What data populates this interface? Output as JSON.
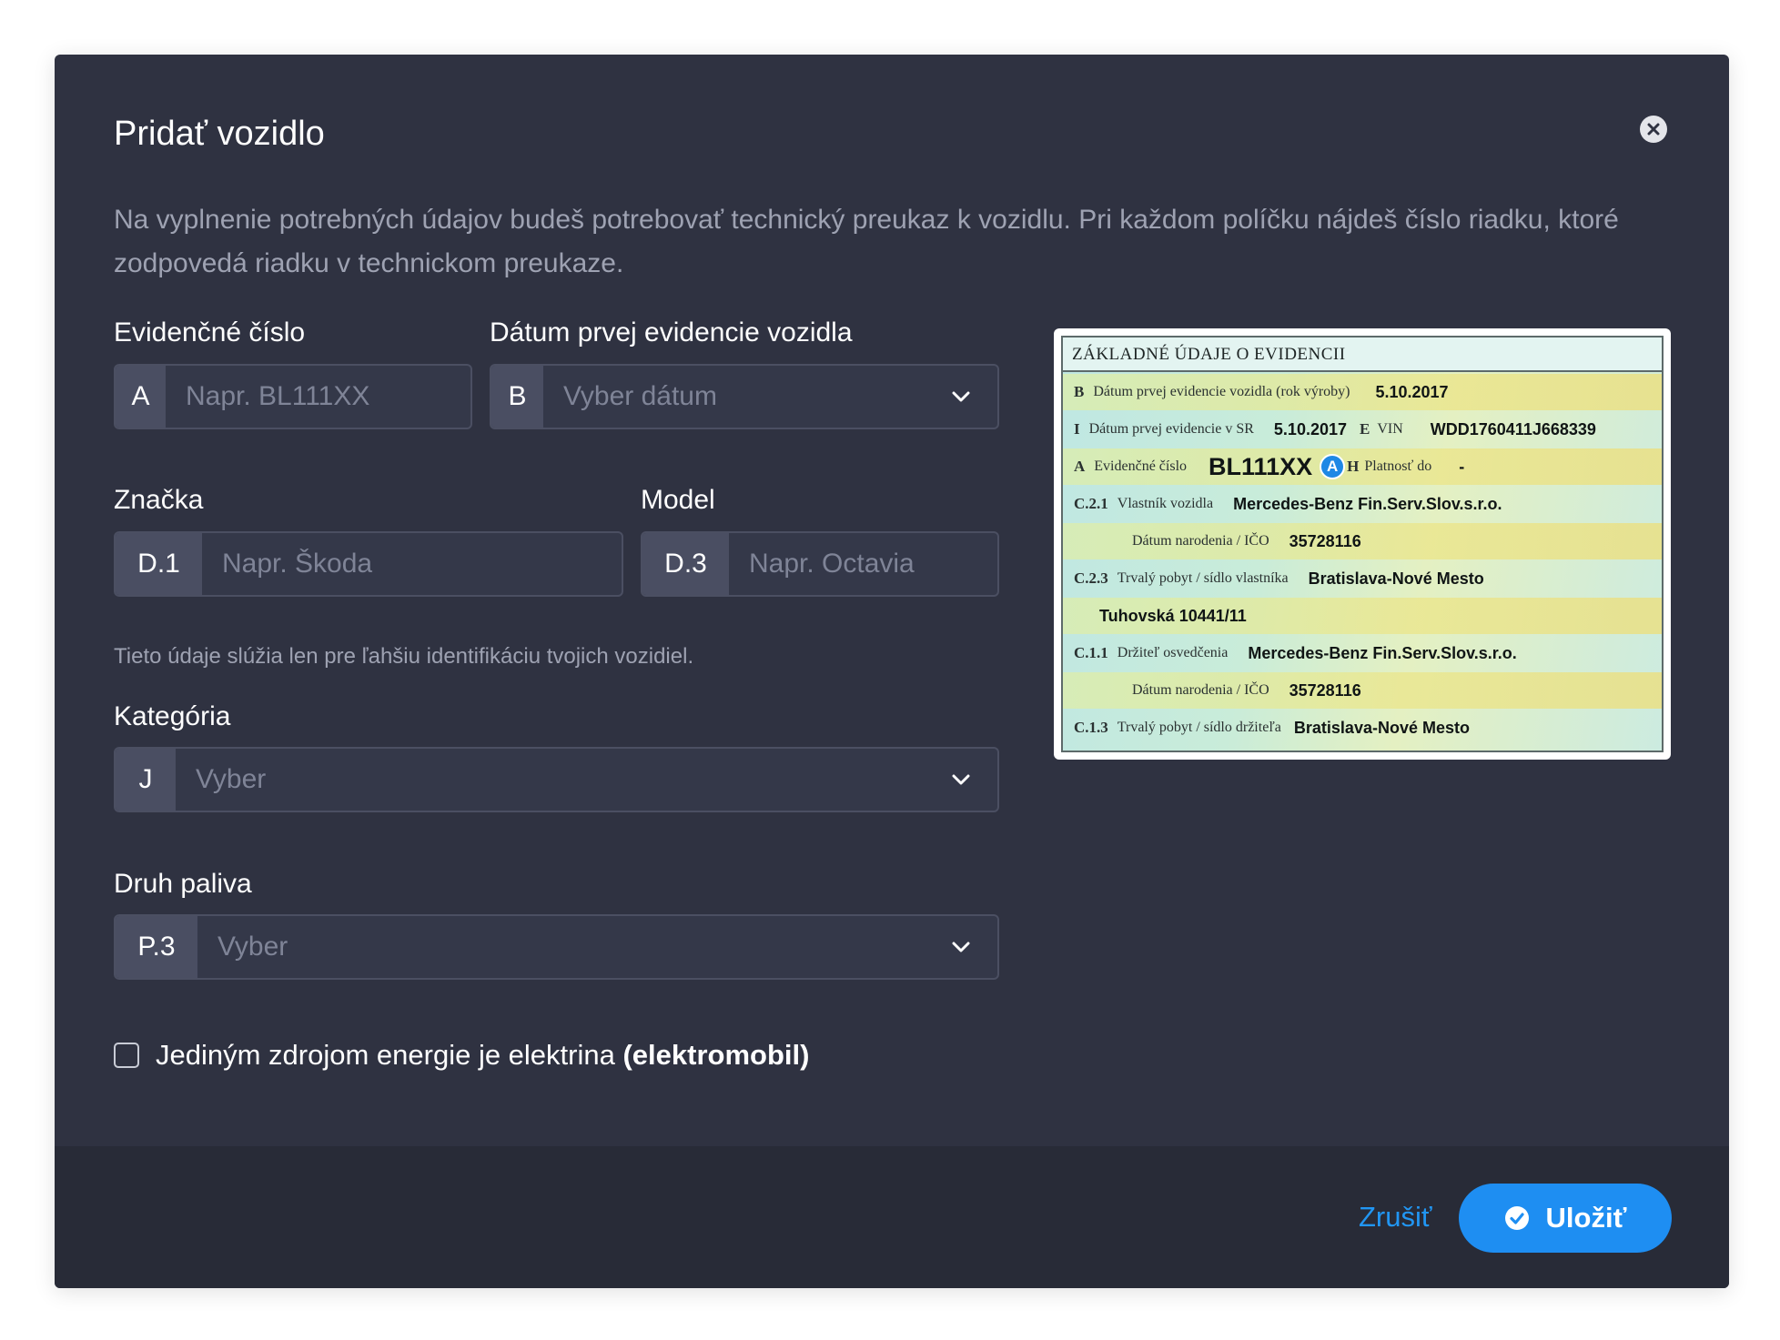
{
  "dialog": {
    "title": "Pridať vozidlo",
    "close_icon": "close-icon",
    "intro": "Na vyplnenie potrebných údajov budeš potrebovať technický preukaz k vozidlu. Pri každom políčku nájdeš číslo riadku, ktoré zodpovedá riadku v technickom preukaze."
  },
  "fields": {
    "plate": {
      "label": "Evidenčné číslo",
      "prefix": "A",
      "placeholder": "Napr. BL111XX",
      "value": ""
    },
    "first_registration": {
      "label": "Dátum prvej evidencie vozidla",
      "prefix": "B",
      "placeholder": "Vyber dátum"
    },
    "brand": {
      "label": "Značka",
      "prefix": "D.1",
      "placeholder": "Napr. Škoda",
      "value": ""
    },
    "model": {
      "label": "Model",
      "prefix": "D.3",
      "placeholder": "Napr. Octavia",
      "value": ""
    },
    "hint": "Tieto údaje slúžia len pre ľahšiu identifikáciu tvojich vozidiel.",
    "category": {
      "label": "Kategória",
      "prefix": "J",
      "placeholder": "Vyber"
    },
    "fuel": {
      "label": "Druh paliva",
      "prefix": "P.3",
      "placeholder": "Vyber"
    },
    "electric": {
      "label": "Jediným zdrojom energie je elektrina",
      "label_bold": "(elektromobil)",
      "checked": false
    }
  },
  "document_image": {
    "title": "ZÁKLADNÉ ÚDAJE O EVIDENCII",
    "rows": [
      {
        "code": "B",
        "label": "Dátum prvej evidencie vozidla (rok výroby)",
        "value": "5.10.2017"
      },
      {
        "code": "I",
        "label": "Dátum prvej evidencie v SR",
        "value": "5.10.2017",
        "code2": "E",
        "label2": "VIN",
        "value2": "WDD1760411J668339"
      },
      {
        "code": "A",
        "label": "Evidenčné číslo",
        "value": "BL111XX",
        "badge": "A",
        "code2": "H",
        "label2": "Platnosť do",
        "value2": "-"
      },
      {
        "code": "C.2.1",
        "label": "Vlastník vozidla",
        "value": "Mercedes-Benz Fin.Serv.Slov.s.r.o."
      },
      {
        "code": "",
        "label": "Dátum narodenia / IČO",
        "value": "35728116"
      },
      {
        "code": "C.2.3",
        "label": "Trvalý pobyt / sídlo vlastníka",
        "value": "Bratislava-Nové Mesto"
      },
      {
        "code": "",
        "label": "",
        "value": "Tuhovská 10441/11"
      },
      {
        "code": "C.1.1",
        "label": "Držiteľ osvedčenia",
        "value": "Mercedes-Benz Fin.Serv.Slov.s.r.o."
      },
      {
        "code": "",
        "label": "Dátum narodenia / IČO",
        "value": "35728116"
      },
      {
        "code": "C.1.3",
        "label": "Trvalý pobyt / sídlo držiteľa",
        "value": "Bratislava-Nové Mesto"
      }
    ]
  },
  "footer": {
    "cancel_label": "Zrušiť",
    "save_label": "Uložiť",
    "save_icon": "check-circle-icon"
  },
  "colors": {
    "modal_bg": "#2f3241",
    "footer_bg": "#282b37",
    "accent": "#1e8ef2",
    "prefix_bg": "#4a4e62"
  }
}
